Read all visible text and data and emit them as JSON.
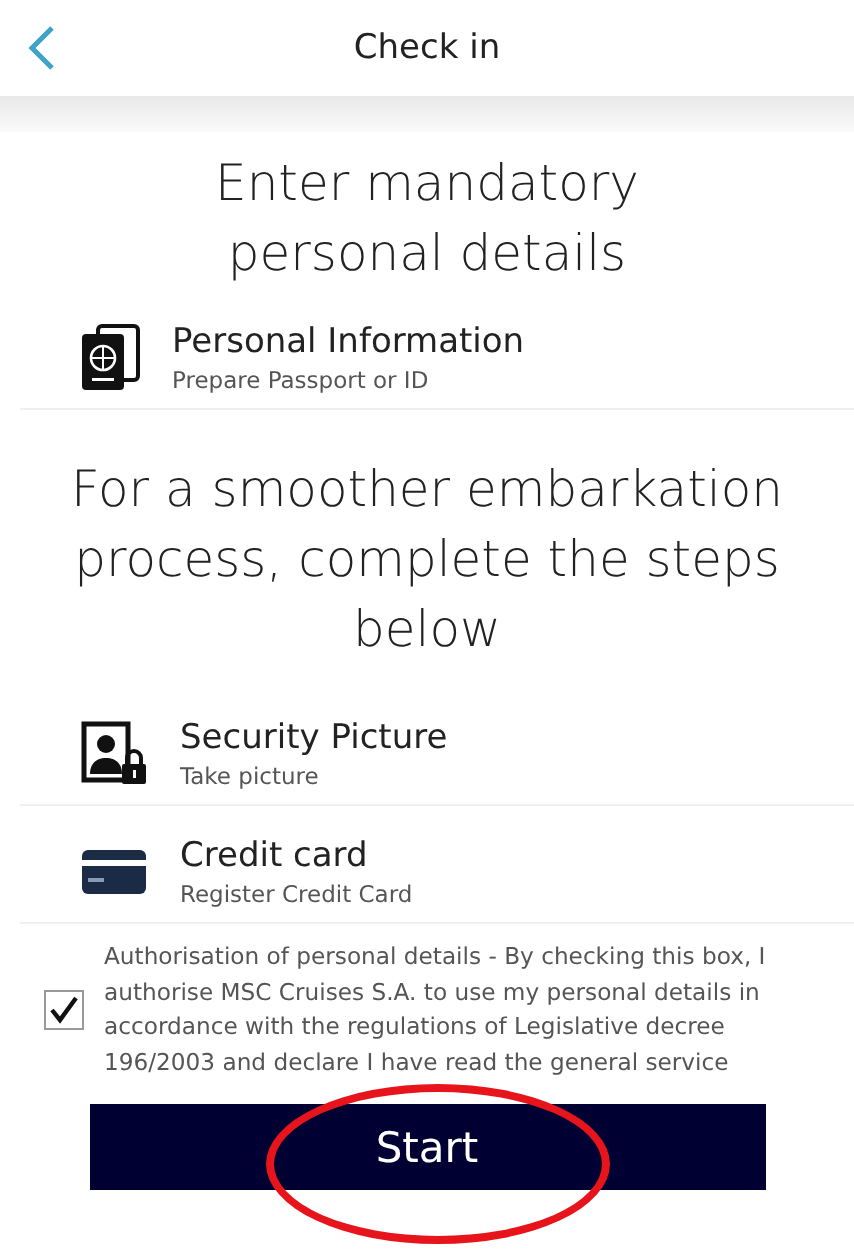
{
  "header": {
    "title": "Check in"
  },
  "mandatory": {
    "heading": "Enter mandatory personal details",
    "steps": [
      {
        "kind": "passport",
        "title": "Personal Information",
        "subtitle": "Prepare Passport or ID"
      }
    ]
  },
  "optional": {
    "heading": "For a smoother embarkation process, complete the steps below",
    "steps": [
      {
        "kind": "security",
        "title": "Security Picture",
        "subtitle": "Take picture"
      },
      {
        "kind": "card",
        "title": "Credit card",
        "subtitle": "Register Credit Card"
      }
    ]
  },
  "consent": {
    "checked": true,
    "text": "Authorisation of personal details - By checking this box, I authorise MSC Cruises S.A. to use my personal details in accordance with the regulations of Legislative decree 196/2003 and declare I have read the general service"
  },
  "start_button": {
    "label": "Start",
    "highlighted": true
  }
}
